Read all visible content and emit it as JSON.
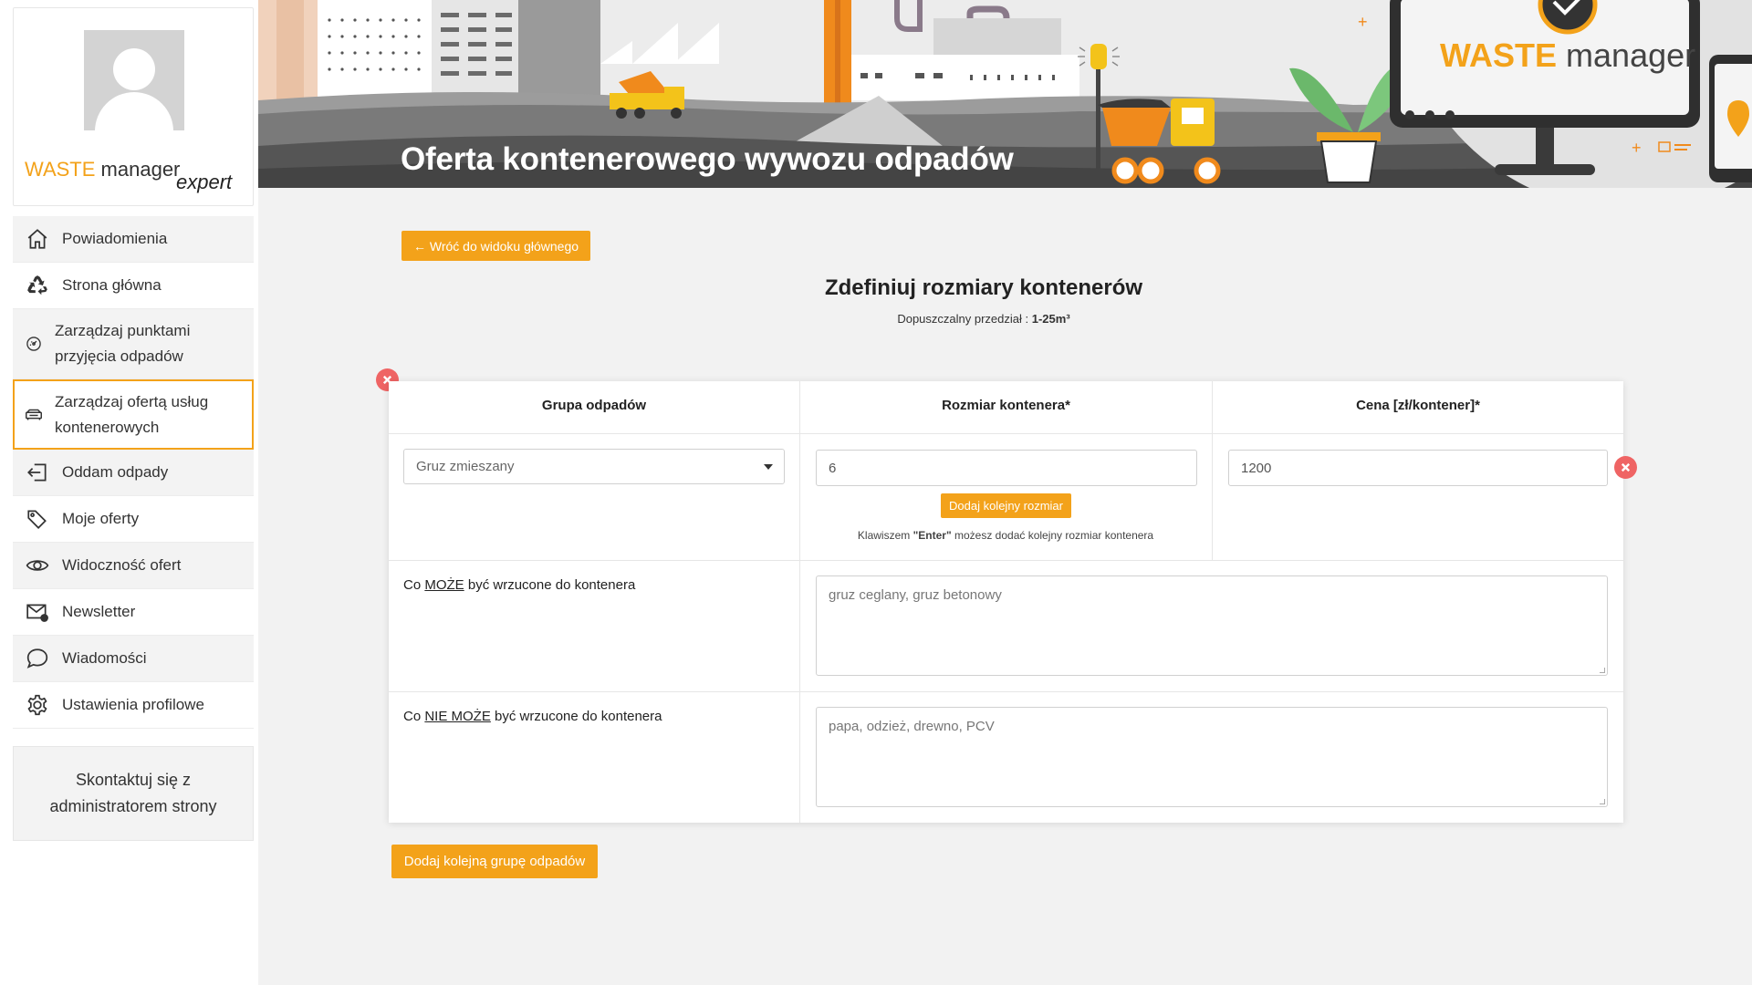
{
  "sidebar": {
    "brand": {
      "waste": "WASTE",
      "manager": "manager",
      "expert": "expert"
    },
    "items": [
      {
        "label": "Powiadomienia",
        "icon": "home-icon"
      },
      {
        "label": "Strona główna",
        "icon": "recycle-icon"
      },
      {
        "label": "Zarządzaj punktami przyjęcia odpadów",
        "icon": "gauge-icon"
      },
      {
        "label": "Zarządzaj ofertą usług kontenerowych",
        "icon": "container-icon",
        "active": true
      },
      {
        "label": "Oddam odpady",
        "icon": "login-arrow-icon"
      },
      {
        "label": "Moje oferty",
        "icon": "tag-icon"
      },
      {
        "label": "Widoczność ofert",
        "icon": "eye-icon"
      },
      {
        "label": "Newsletter",
        "icon": "envelope-alert-icon"
      },
      {
        "label": "Wiadomości",
        "icon": "chat-bubble-icon"
      },
      {
        "label": "Ustawienia profilowe",
        "icon": "gear-icon"
      }
    ],
    "contact": "Skontaktuj się z administratorem strony"
  },
  "banner": {
    "title": "Oferta kontenerowego wywozu odpadów",
    "logo_waste": "WASTE",
    "logo_manager": "manager"
  },
  "content": {
    "back_button": "← Wróć do widoku głównego",
    "title": "Zdefiniuj rozmiary kontenerów",
    "subtitle_prefix": "Dopuszczalny przedział : ",
    "subtitle_range": "1-25m³"
  },
  "table": {
    "headers": [
      "Grupa odpadów",
      "Rozmiar kontenera*",
      "Cena [zł/kontener]*"
    ],
    "waste_group": "Gruz zmieszany",
    "size": "6",
    "price": "1200",
    "add_size_button": "Dodaj kolejny rozmiar",
    "hint_prefix": "Klawiszem ",
    "hint_key": "\"Enter\"",
    "hint_suffix": " możesz dodać kolejny rozmiar kontenera",
    "can_label_pre": "Co ",
    "can_label_key": "MOŻE",
    "can_label_post": " być wrzucone do kontenera",
    "can_value": "gruz ceglany, gruz betonowy",
    "cannot_label_pre": "Co ",
    "cannot_label_key": "NIE MOŻE",
    "cannot_label_post": " być wrzucone do kontenera",
    "cannot_value": "papa, odzież, drewno, PCV"
  },
  "add_group_button": "Dodaj kolejną grupę odpadów",
  "colors": {
    "accent": "#f3a21a",
    "danger": "#ef6464",
    "banner_dark": "#4a4a4a"
  }
}
